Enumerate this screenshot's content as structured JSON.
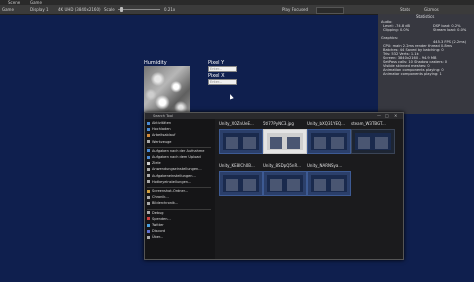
{
  "tabs": [
    "Scene",
    "Game"
  ],
  "toolbar": {
    "game": "Game",
    "display": "Display 1",
    "resolution": "4K UHD (3840x2160)",
    "scale_label": "Scale",
    "scale_value": "0.21x",
    "play_mode": "Play Focused",
    "right_items": [
      "Stats",
      "Gizmos"
    ]
  },
  "stats": {
    "title": "Statistics",
    "audio_header": "Audio:",
    "audio": [
      "Level: -74.8 dB",
      "Clipping: 0.0%"
    ],
    "audio_right": [
      "DSP load: 0.2%",
      "Stream load: 0.0%"
    ],
    "graphics_header": "Graphics:",
    "fps": "445.3 FPS (2.2ms)",
    "graphics": [
      "CPU: main 2.2ms  render thread 0.8ms",
      "Batches: 44     Saved by batching: 0",
      "Tris: 532       Verts: 1.1k",
      "Screen: 3840x2160 - 94.9 MB",
      "SetPass calls: 10   Shadow casters: 0",
      "Visible skinned meshes: 0",
      "Animation components playing: 0",
      "Animator components playing: 1"
    ]
  },
  "scene": {
    "humidity_label": "Humidity",
    "pixel_y_label": "Pixel Y",
    "pixel_x_label": "Pixel X",
    "pixel_y_placeholder": "Enter...",
    "pixel_x_placeholder": "Enter..."
  },
  "window": {
    "title": "Search Tool",
    "controls": [
      "—",
      "□",
      "✕"
    ]
  },
  "menu": [
    {
      "label": "Aktivitäten",
      "color": "#4a8bd6"
    },
    {
      "label": "Hochladen",
      "color": "#4a8bd6"
    },
    {
      "label": "Arbeitsablauf",
      "color": "#d08a3c"
    },
    {
      "label": "Werkzeuge",
      "color": "#aaaaaa"
    },
    {
      "sep": true
    },
    {
      "label": "Aufgaben nach der Aufnahme",
      "color": "#4a8bd6"
    },
    {
      "label": "Aufgaben nach dem Upload",
      "color": "#4a8bd6"
    },
    {
      "label": "Ziele",
      "color": "#d0d0d0"
    },
    {
      "label": "Anwendungseinstellungen...",
      "color": "#aaaaaa"
    },
    {
      "label": "Aufgabeneinstellungen...",
      "color": "#aaaaaa"
    },
    {
      "label": "Hotkeyeinstellungen...",
      "color": "#aaaaaa"
    },
    {
      "sep": true
    },
    {
      "label": "Screenshot-Ordner...",
      "color": "#d0a040"
    },
    {
      "label": "Chronik...",
      "color": "#aaaaaa"
    },
    {
      "label": "Bilderchronik...",
      "color": "#aaaaaa"
    },
    {
      "sep": true
    },
    {
      "label": "Debug",
      "color": "#aaaaaa"
    },
    {
      "label": "Spenden...",
      "color": "#d04040"
    },
    {
      "label": "Twitter",
      "color": "#4aa0e0"
    },
    {
      "label": "Discord",
      "color": "#6070d0"
    },
    {
      "label": "Über...",
      "color": "#aaaaaa"
    }
  ],
  "thumbnails": [
    {
      "title": "Unity_X0ZnUeE...",
      "style": "blue"
    },
    {
      "title": "5tl77PyNC3.jpg",
      "style": "light"
    },
    {
      "title": "Unity_bXQ31YEQ...",
      "style": "blue"
    },
    {
      "title": "steam_W3TBGT...",
      "style": "dark"
    },
    {
      "title": "Unity_KE8ICh0B...",
      "style": "blue"
    },
    {
      "title": "Unity_8SDpQ5nR...",
      "style": "blue"
    },
    {
      "title": "Unity_NARNSya...",
      "style": "blue"
    }
  ]
}
